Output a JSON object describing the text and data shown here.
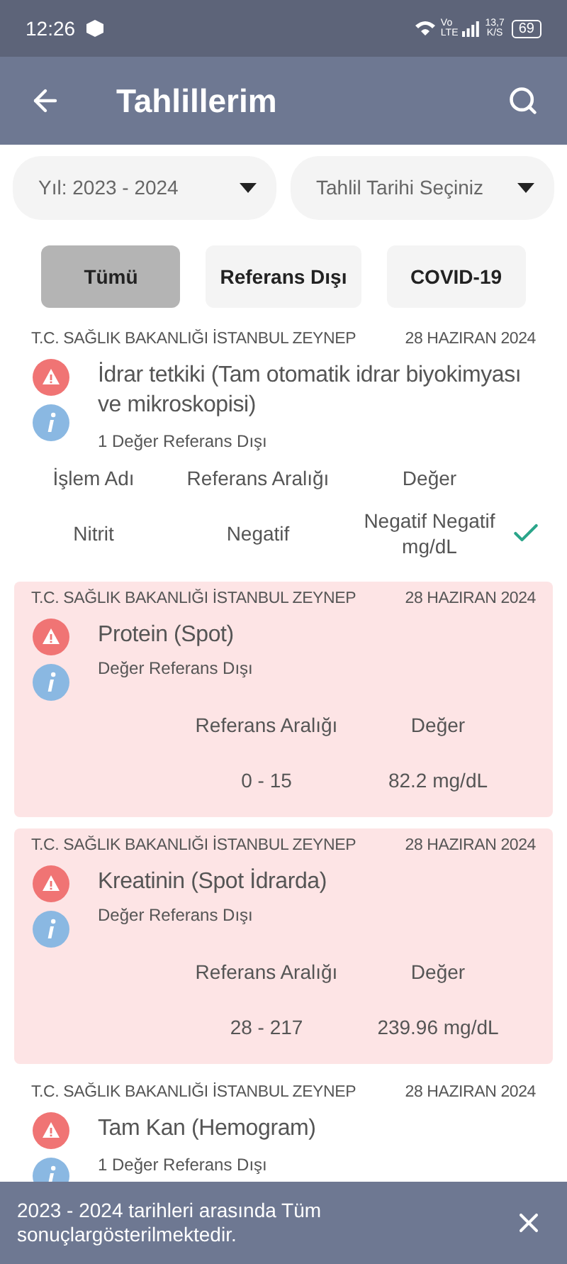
{
  "status_bar": {
    "time": "12:26",
    "volte_top": "Vo",
    "volte_bottom": "LTE",
    "speed_value": "13,7",
    "speed_unit": "K/S",
    "battery": "69"
  },
  "app_bar": {
    "title": "Tahlillerim"
  },
  "dropdowns": [
    {
      "value": "Yıl: 2023 - 2024"
    },
    {
      "value": "Tahlil Tarihi Seçiniz"
    }
  ],
  "filters": [
    {
      "label": "Tümü",
      "selected": true
    },
    {
      "label": "Referans Dışı",
      "selected": false
    },
    {
      "label": "COVID-19",
      "selected": false
    }
  ],
  "results": [
    {
      "institution": "T.C. SAĞLIK BAKANLIĞI İSTANBUL ZEYNEP",
      "date": "28 HAZIRAN 2024",
      "title": "İdrar tetkiki (Tam otomatik idrar biyokimyası ve mikroskopisi)",
      "out_of_range": false,
      "note": "1 Değer Referans Dışı",
      "columns": [
        "İşlem Adı",
        "Referans Aralığı",
        "Değer"
      ],
      "rows": [
        {
          "name": "Nitrit",
          "range": "Negatif",
          "value": "Negatif Negatif mg/dL",
          "within_range": true
        }
      ]
    },
    {
      "institution": "T.C. SAĞLIK BAKANLIĞI İSTANBUL ZEYNEP",
      "date": "28 HAZIRAN 2024",
      "title": "Protein (Spot)",
      "out_of_range": true,
      "note": "Değer Referans Dışı",
      "columns": [
        "Referans Aralığı",
        "Değer"
      ],
      "rows": [
        {
          "range": "0 - 15",
          "value": "82.2 mg/dL",
          "within_range": false
        }
      ]
    },
    {
      "institution": "T.C. SAĞLIK BAKANLIĞI İSTANBUL ZEYNEP",
      "date": "28 HAZIRAN 2024",
      "title": "Kreatinin (Spot İdrarda)",
      "out_of_range": true,
      "note": "Değer Referans Dışı",
      "columns": [
        "Referans Aralığı",
        "Değer"
      ],
      "rows": [
        {
          "range": "28 - 217",
          "value": "239.96 mg/dL",
          "within_range": false
        }
      ]
    },
    {
      "institution": "T.C. SAĞLIK BAKANLIĞI İSTANBUL ZEYNEP",
      "date": "28 HAZIRAN 2024",
      "title": "Tam Kan (Hemogram)",
      "out_of_range": false,
      "note": "1 Değer Referans Dışı"
    }
  ],
  "snackbar": {
    "message": "2023 - 2024 tarihleri arasında Tüm sonuçlargösterilmektedir."
  }
}
